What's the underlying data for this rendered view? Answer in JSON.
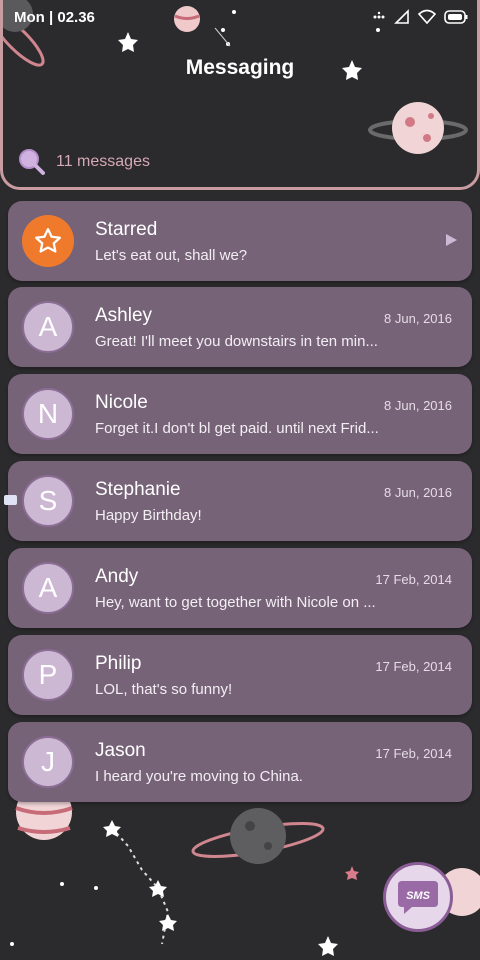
{
  "status_bar": {
    "time": "Mon | 02.36",
    "icons": [
      "dots-icon",
      "signal-icon",
      "wifi-icon",
      "battery-icon"
    ]
  },
  "header": {
    "title": "Messaging",
    "message_count": "11 messages",
    "search_icon": "search-icon"
  },
  "colors": {
    "card": "#776378",
    "accent": "#ef7a2c",
    "header_border": "#c99ca2",
    "avatar": "#cdb8d4",
    "background": "#2b2a2c"
  },
  "conversations": [
    {
      "initial": "",
      "name": "Starred",
      "preview": "Let's eat out, shall we?",
      "date": "",
      "icon": "star-icon"
    },
    {
      "initial": "A",
      "name": "Ashley",
      "preview": "Great! I'll meet you downstairs in ten min...",
      "date": "8 Jun, 2016"
    },
    {
      "initial": "N",
      "name": "Nicole",
      "preview": "Forget it.I don't bl get paid. until next Frid...",
      "date": "8 Jun, 2016"
    },
    {
      "initial": "S",
      "name": "Stephanie",
      "preview": "Happy Birthday!",
      "date": "8 Jun, 2016"
    },
    {
      "initial": "A",
      "name": "Andy",
      "preview": "Hey, want to get together with Nicole on ...",
      "date": "17 Feb, 2014"
    },
    {
      "initial": "P",
      "name": "Philip",
      "preview": "LOL, that's so funny!",
      "date": "17 Feb, 2014"
    },
    {
      "initial": "J",
      "name": "Jason",
      "preview": "I heard you're moving to China.",
      "date": "17 Feb, 2014"
    }
  ],
  "fab": {
    "label": "SMS",
    "icon": "chat-bubble-icon"
  }
}
